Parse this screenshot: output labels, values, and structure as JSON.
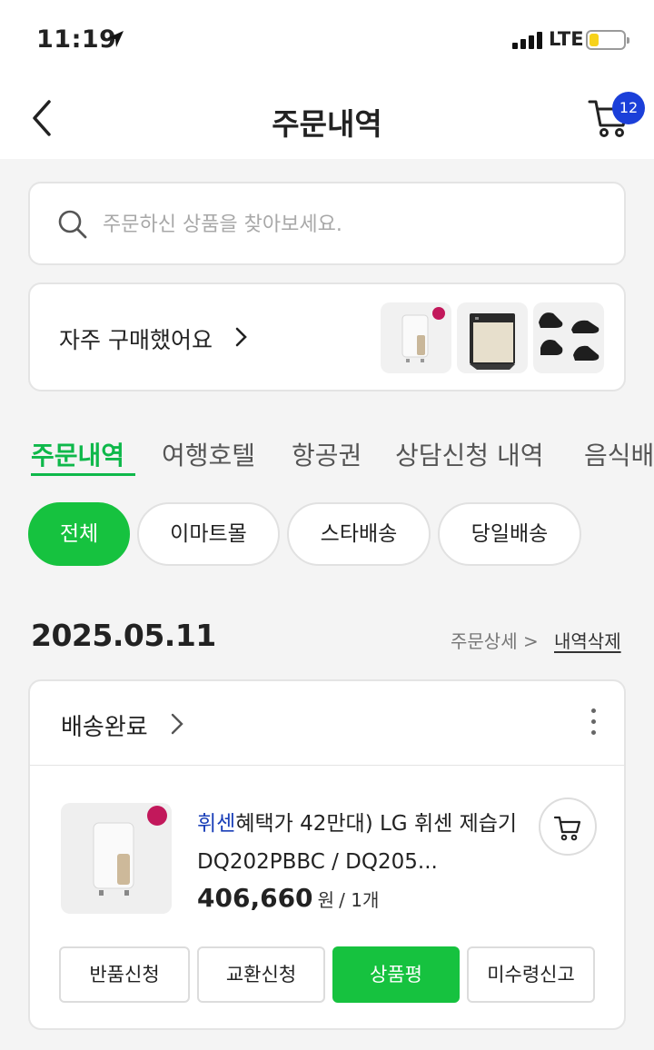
{
  "status_bar": {
    "time": "11:19",
    "network": "LTE"
  },
  "header": {
    "title": "주문내역",
    "cart_count": "12"
  },
  "search": {
    "placeholder": "주문하신 상품을 찾아보세요."
  },
  "frequent": {
    "label": "자주 구매했어요"
  },
  "tabs": [
    "주문내역",
    "여행호텔",
    "항공권",
    "상담신청 내역",
    "음식배"
  ],
  "filters": [
    "전체",
    "이마트몰",
    "스타배송",
    "당일배송"
  ],
  "order_group": {
    "date": "2025.05.11",
    "detail_link": "주문상세 >",
    "delete_link": "내역삭제"
  },
  "order": {
    "status": "배송완료",
    "product": {
      "brand": "휘센",
      "name": "혜택가 42만대) LG 휘센 제습기 DQ202PBBC / DQ205...",
      "price": "406,660",
      "currency": "원",
      "quantity": "/ 1개"
    },
    "actions": [
      "반품신청",
      "교환신청",
      "상품평",
      "미수령신고"
    ]
  },
  "colors": {
    "accent": "#16c23f",
    "tab_active": "#0eb84a",
    "badge": "#1b3fd9",
    "brand_text": "#1a3fb8"
  }
}
